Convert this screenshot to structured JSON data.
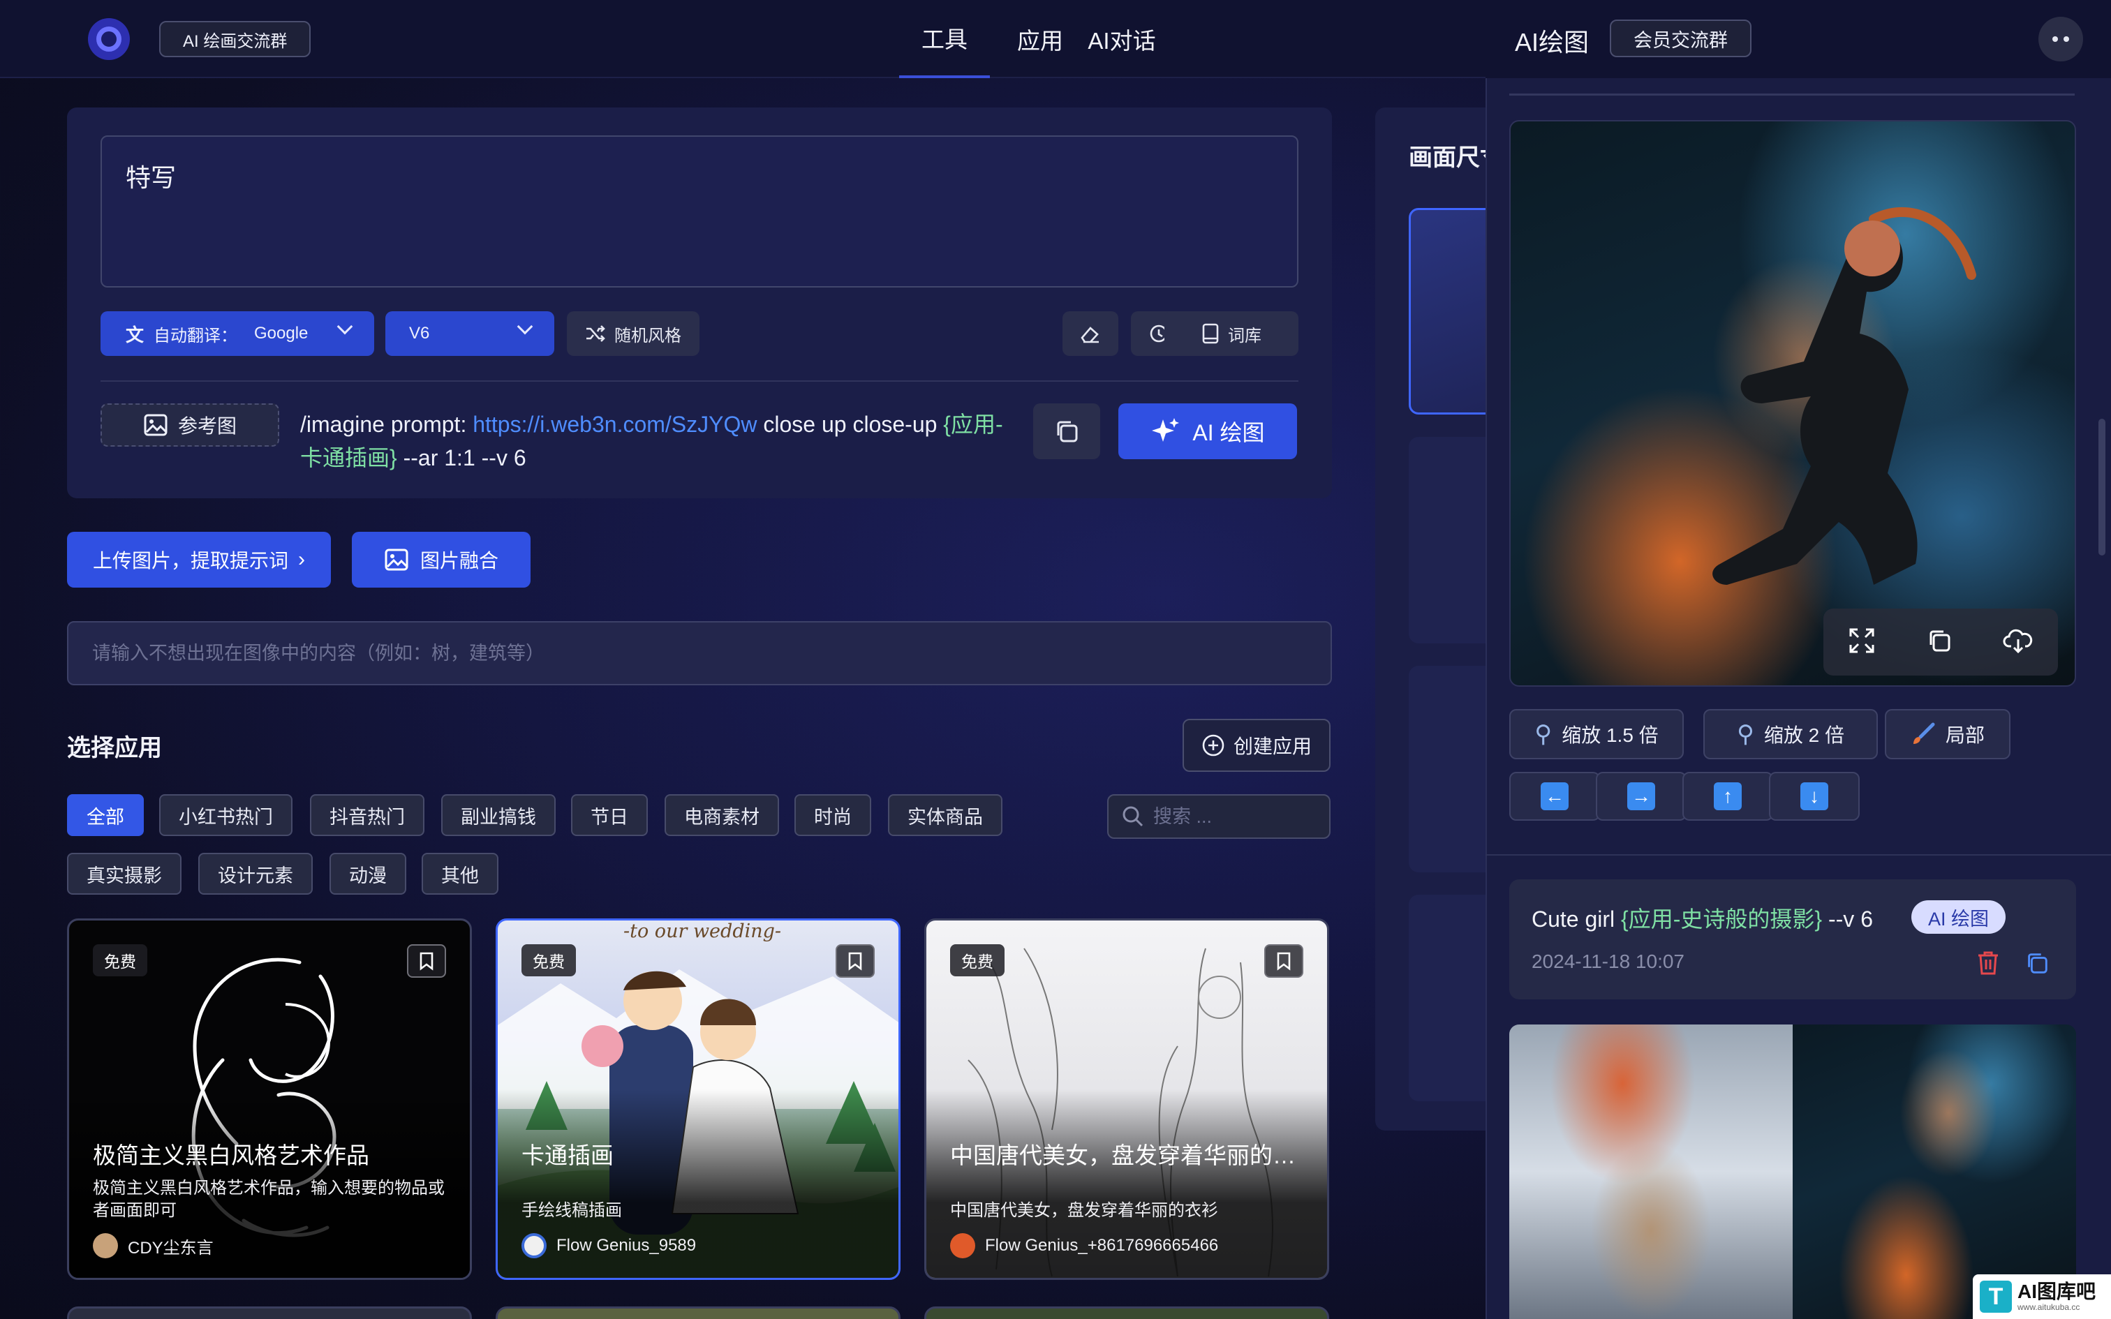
{
  "header": {
    "group_label": "AI 绘画交流群",
    "nav": [
      "工具",
      "应用",
      "AI对话"
    ]
  },
  "prompt": {
    "text": "特写",
    "translate_label": "自动翻译：",
    "translate_value": "Google",
    "version": "V6",
    "random_style": "随机风格",
    "lexicon": "词库",
    "ref_image": "参考图",
    "cmd_prefix": "/imagine prompt: ",
    "cmd_link": "https://i.web3n.com/SzJYQw",
    "cmd_mid": " close up close-up ",
    "cmd_app": "{应用-卡通插画}",
    "cmd_suffix": " --ar 1:1 --v 6",
    "draw_label": "AI 绘图"
  },
  "actions": {
    "upload": "上传图片，提取提示词",
    "fuse": "图片融合",
    "negative_placeholder": "请输入不想出现在图像中的内容（例如：树，建筑等）"
  },
  "apps": {
    "title": "选择应用",
    "create": "创建应用",
    "search_placeholder": "搜索 ...",
    "categories_row1": [
      "全部",
      "小红书热门",
      "抖音热门",
      "副业搞钱",
      "节日",
      "电商素材",
      "时尚",
      "实体商品"
    ],
    "categories_row2": [
      "真实摄影",
      "设计元素",
      "动漫",
      "其他"
    ],
    "cards": [
      {
        "badge": "免费",
        "title": "极简主义黑白风格艺术作品",
        "desc": "极简主义黑白风格艺术作品，输入想要的物品或者画面即可",
        "author": "CDY尘东言",
        "art_text": ""
      },
      {
        "badge": "免费",
        "title": "卡通插画",
        "desc": "手绘线稿插画",
        "author": "Flow Genius_9589",
        "art_text": "-to our wedding-"
      },
      {
        "badge": "免费",
        "title": "中国唐代美女，盘发穿着华丽的衣衫",
        "desc": "中国唐代美女，盘发穿着华丽的衣衫",
        "author": "Flow Genius_+8617696665466",
        "art_text": ""
      }
    ]
  },
  "side": {
    "title": "画面尺寸"
  },
  "drawer": {
    "title": "AI绘图",
    "group": "会员交流群",
    "zoom1": "缩放 1.5 倍",
    "zoom2": "缩放 2 倍",
    "partial": "局部",
    "arrows": [
      "←",
      "→",
      "↑",
      "↓"
    ],
    "record": {
      "prompt": "Cute girl ",
      "app": "{应用-史诗般的摄影}",
      "suffix": " --v 6",
      "tag": "AI 绘图",
      "date": "2024-11-18 10:07"
    }
  },
  "watermark": {
    "logo": "T",
    "name": "AI图库吧",
    "url": "www.aitukuba.cc"
  },
  "colors": {
    "accent": "#3050e2",
    "app_green": "#7fe0a4",
    "link_blue": "#4f8dff",
    "delete_red": "#e5484d"
  }
}
